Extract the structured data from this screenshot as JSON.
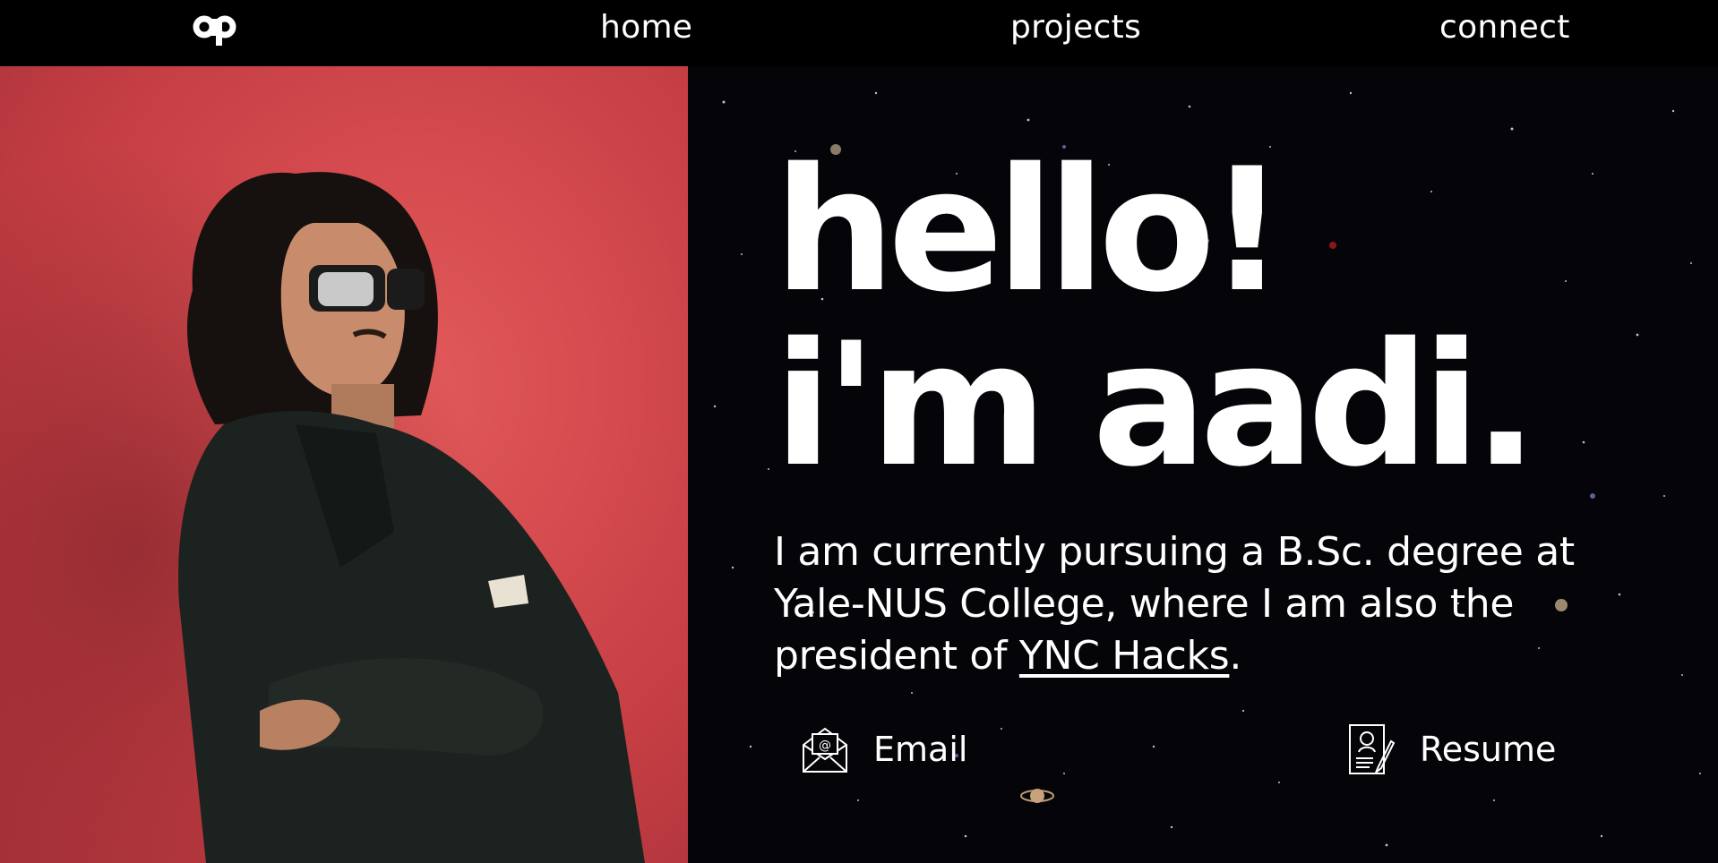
{
  "nav": {
    "logo_text": "ap",
    "home": "home",
    "projects": "projects",
    "connect": "connect"
  },
  "hero": {
    "line1": "hello!",
    "line2": "i'm aadi."
  },
  "bio": {
    "part1": "I am currently pursuing a B.Sc. degree at Yale-NUS College, where I am also the president of ",
    "link": "YNC Hacks",
    "part2": "."
  },
  "cta": {
    "email_label": "Email",
    "resume_label": "Resume"
  },
  "colors": {
    "background": "#000000",
    "photo_backdrop": "#d44a4e",
    "text": "#ffffff"
  }
}
